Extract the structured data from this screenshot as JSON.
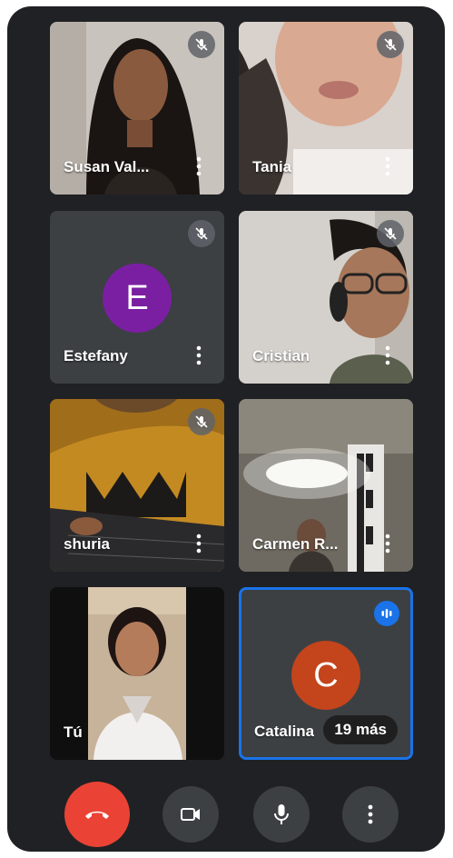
{
  "participants": [
    {
      "name": "Susan Val...",
      "muted": true
    },
    {
      "name": "Tania",
      "muted": true
    },
    {
      "name": "Estefany",
      "muted": true,
      "avatar_letter": "E",
      "avatar_color": "#7b1fa2"
    },
    {
      "name": "Cristian",
      "muted": true
    },
    {
      "name": "shuria",
      "muted": true
    },
    {
      "name": "Carmen R...",
      "muted": false
    },
    {
      "name": "Tú",
      "muted": false
    },
    {
      "name": "Catalina",
      "muted": false,
      "speaking": true,
      "avatar_letter": "C",
      "avatar_color": "#c4441c"
    }
  ],
  "overflow_label": "19 más",
  "controls": {
    "end_call": "phone-hangup-icon",
    "camera": "video-camera-icon",
    "microphone": "microphone-icon",
    "more": "more-vertical-icon"
  },
  "colors": {
    "background": "#202124",
    "tile": "#3c4043",
    "end_call": "#ea4335",
    "active_speaker": "#1a73e8"
  }
}
